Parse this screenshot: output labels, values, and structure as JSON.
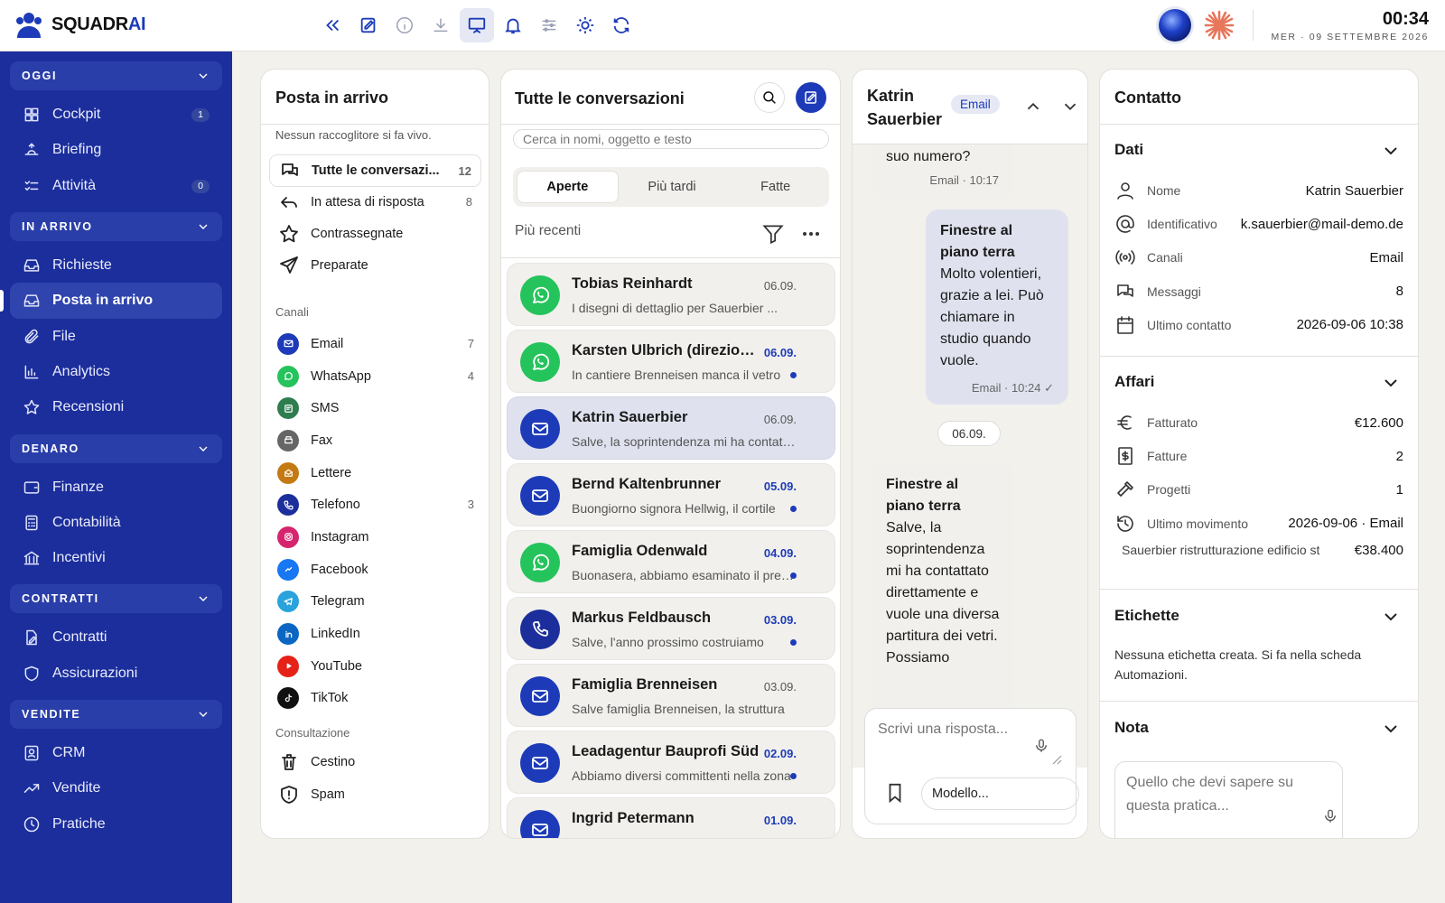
{
  "brand": {
    "name_main": "SQUADR",
    "name_accent": "AI"
  },
  "clock": {
    "time": "00:34",
    "date": "MER · 09 SETTEMBRE 2026"
  },
  "toolbar": {
    "icons": [
      "double-chevron-left-icon",
      "compose-icon",
      "info-icon",
      "download-icon",
      "presentation-icon",
      "bell-icon",
      "sliders-icon",
      "sun-icon",
      "refresh-icon"
    ]
  },
  "sidebar": {
    "sections": [
      {
        "label": "OGGI",
        "items": [
          {
            "label": "Cockpit",
            "badge": "1"
          },
          {
            "label": "Briefing",
            "badge": ""
          },
          {
            "label": "Attività",
            "badge": "0"
          }
        ]
      },
      {
        "label": "IN ARRIVO",
        "items": [
          {
            "label": "Richieste",
            "badge": ""
          },
          {
            "label": "Posta in arrivo",
            "badge": "",
            "active": true
          },
          {
            "label": "File",
            "badge": ""
          },
          {
            "label": "Analytics",
            "badge": ""
          },
          {
            "label": "Recensioni",
            "badge": ""
          }
        ]
      },
      {
        "label": "DENARO",
        "items": [
          {
            "label": "Finanze",
            "badge": ""
          },
          {
            "label": "Contabilità",
            "badge": ""
          },
          {
            "label": "Incentivi",
            "badge": ""
          }
        ]
      },
      {
        "label": "CONTRATTI",
        "items": [
          {
            "label": "Contratti",
            "badge": ""
          },
          {
            "label": "Assicurazioni",
            "badge": ""
          }
        ]
      },
      {
        "label": "VENDITE",
        "items": [
          {
            "label": "CRM",
            "badge": ""
          },
          {
            "label": "Vendite",
            "badge": ""
          },
          {
            "label": "Pratiche",
            "badge": ""
          }
        ]
      }
    ]
  },
  "inbox": {
    "title": "Posta in arrivo",
    "subtitle": "Nessun raccoglitore si fa vivo.",
    "folders": [
      {
        "label": "Tutte le conversazi...",
        "count": "12"
      },
      {
        "label": "In attesa di risposta",
        "count": "8"
      },
      {
        "label": "Contrassegnate",
        "count": ""
      },
      {
        "label": "Preparate",
        "count": ""
      }
    ],
    "channels_label": "Canali",
    "channels": [
      {
        "label": "Email",
        "count": "7",
        "color": "#1d3bb8"
      },
      {
        "label": "WhatsApp",
        "count": "4",
        "color": "#25c35c"
      },
      {
        "label": "SMS",
        "count": "",
        "color": "#2e7d4f"
      },
      {
        "label": "Fax",
        "count": "",
        "color": "#666666"
      },
      {
        "label": "Lettere",
        "count": "",
        "color": "#c47a12"
      },
      {
        "label": "Telefono",
        "count": "3",
        "color": "#1c2e9c"
      },
      {
        "label": "Instagram",
        "count": "",
        "color": "#d6246e"
      },
      {
        "label": "Facebook",
        "count": "",
        "color": "#1877f2"
      },
      {
        "label": "Telegram",
        "count": "",
        "color": "#2aa3dd"
      },
      {
        "label": "LinkedIn",
        "count": "",
        "color": "#0a66c2"
      },
      {
        "label": "YouTube",
        "count": "",
        "color": "#e62117"
      },
      {
        "label": "TikTok",
        "count": "",
        "color": "#111111"
      }
    ],
    "review_label": "Consultazione",
    "review": [
      {
        "label": "Cestino"
      },
      {
        "label": "Spam"
      }
    ]
  },
  "conversations": {
    "title": "Tutte le conversazioni",
    "search_placeholder": "Cerca in nomi, oggetto e testo",
    "tabs": [
      "Aperte",
      "Più tardi",
      "Fatte"
    ],
    "sort_label": "Più recenti",
    "items": [
      {
        "name": "Tobias Reinhardt",
        "date": "06.09.",
        "preview": "I disegni di dettaglio per Sauerbier ...",
        "channel": "whatsapp",
        "unread": false
      },
      {
        "name": "Karsten Ulbrich (direzione lavori)",
        "date": "06.09.",
        "preview": "In cantiere Brenneisen manca il vetro",
        "channel": "whatsapp",
        "unread": true
      },
      {
        "name": "Katrin Sauerbier",
        "date": "06.09.",
        "preview": "Salve, la soprintendenza mi ha contattato",
        "channel": "email",
        "unread": false,
        "selected": true
      },
      {
        "name": "Bernd Kaltenbrunner",
        "date": "05.09.",
        "preview": "Buongiorno signora Hellwig, il cortile",
        "channel": "email",
        "unread": true
      },
      {
        "name": "Famiglia Odenwald",
        "date": "04.09.",
        "preview": "Buonasera, abbiamo esaminato il preventivo",
        "channel": "whatsapp",
        "unread": true
      },
      {
        "name": "Markus Feldbausch",
        "date": "03.09.",
        "preview": "Salve, l'anno prossimo costruiamo",
        "channel": "phone",
        "unread": true
      },
      {
        "name": "Famiglia Brenneisen",
        "date": "03.09.",
        "preview": "Salve famiglia Brenneisen, la struttura",
        "channel": "email",
        "unread": false
      },
      {
        "name": "Leadagentur Bauprofi Süd",
        "date": "02.09.",
        "preview": "Abbiamo diversi committenti nella zona",
        "channel": "email",
        "unread": true
      },
      {
        "name": "Ingrid Petermann",
        "date": "01.09.",
        "preview": "",
        "channel": "email",
        "unread": true
      }
    ]
  },
  "thread": {
    "name": "Katrin Sauerbier",
    "channel_badge": "Email",
    "messages": [
      {
        "dir": "in",
        "body": "suo numero?",
        "meta": "Email · 10:17"
      },
      {
        "dir": "out",
        "subject": "Finestre al piano terra",
        "body": "Molto volentieri, grazie a lei. Può chiamare in studio quando vuole.",
        "meta": "Email · 10:24 ✓"
      },
      {
        "dir": "in",
        "subject": "Finestre al piano terra",
        "body": "Salve, la soprintendenza mi ha contattato direttamente e vuole una diversa partitura dei vetri. Possiamo",
        "meta": ""
      }
    ],
    "day_chip": "06.09.",
    "reply_placeholder": "Scrivi una risposta...",
    "template_label": "Modello..."
  },
  "contact": {
    "title": "Contatto",
    "dati": {
      "title": "Dati",
      "rows": [
        {
          "icon": "person-icon",
          "label": "Nome",
          "value": "Katrin Sauerbier"
        },
        {
          "icon": "at-icon",
          "label": "Identificativo",
          "value": "k.sauerbier@mail-demo.de"
        },
        {
          "icon": "broadcast-icon",
          "label": "Canali",
          "value": "Email"
        },
        {
          "icon": "chat-icon",
          "label": "Messaggi",
          "value": "8"
        },
        {
          "icon": "calendar-icon",
          "label": "Ultimo contatto",
          "value": "2026-09-06 10:38"
        }
      ]
    },
    "affari": {
      "title": "Affari",
      "rows": [
        {
          "icon": "euro-icon",
          "label": "Fatturato",
          "value": "€12.600"
        },
        {
          "icon": "invoice-icon",
          "label": "Fatture",
          "value": "2"
        },
        {
          "icon": "hammer-icon",
          "label": "Progetti",
          "value": "1"
        },
        {
          "icon": "history-icon",
          "label": "Ultimo movimento",
          "value": "2026-09-06 · Email"
        }
      ],
      "project": {
        "label": "Sauerbier ristrutturazione edificio st",
        "value": "€38.400"
      }
    },
    "etichette": {
      "title": "Etichette",
      "text": "Nessuna etichetta creata. Si fa nella scheda Automazioni."
    },
    "nota": {
      "title": "Nota",
      "placeholder": "Quello che devi sapere su questa pratica..."
    }
  }
}
